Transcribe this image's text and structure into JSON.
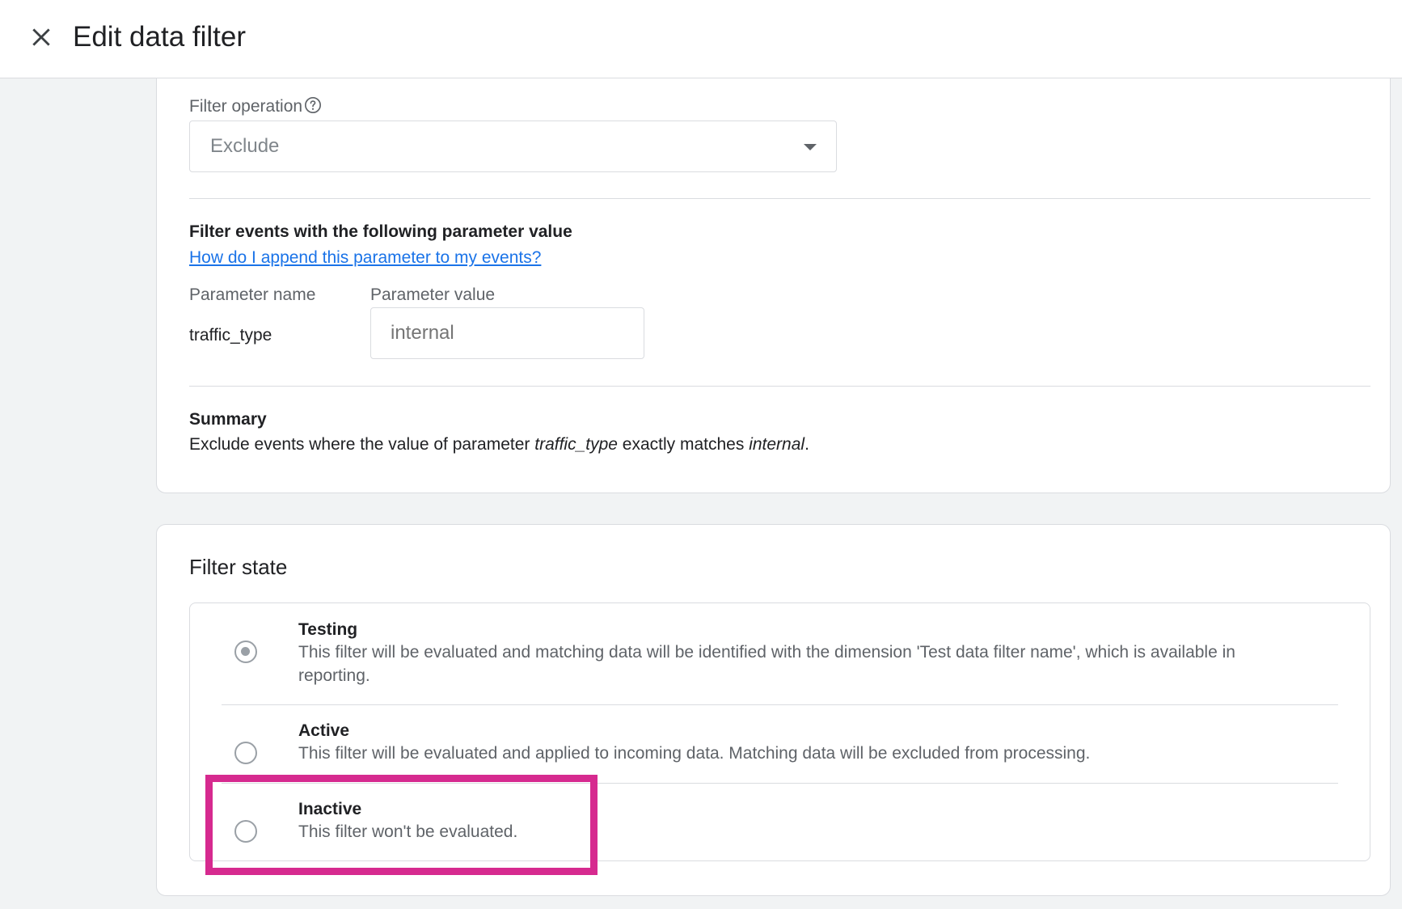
{
  "header": {
    "title": "Edit data filter",
    "close_icon": "close-icon"
  },
  "filter_operation": {
    "label": "Filter operation",
    "help_icon": "help-circle-icon",
    "selected": "Exclude"
  },
  "parameter_section": {
    "heading": "Filter events with the following parameter value",
    "help_link": "How do I append this parameter to my events?",
    "param_name_header": "Parameter name",
    "param_value_header": "Parameter value",
    "param_name": "traffic_type",
    "param_value_placeholder": "internal"
  },
  "summary": {
    "heading": "Summary",
    "text_prefix": "Exclude events where the value of parameter ",
    "param": "traffic_type",
    "text_middle": " exactly matches ",
    "value": "internal",
    "text_suffix": "."
  },
  "filter_state": {
    "title": "Filter state",
    "selected": "Testing",
    "options": [
      {
        "label": "Testing",
        "description": "This filter will be evaluated and matching data will be identified with the dimension 'Test data filter name', which is available in reporting."
      },
      {
        "label": "Active",
        "description": "This filter will be evaluated and applied to incoming data. Matching data will be excluded from processing."
      },
      {
        "label": "Inactive",
        "description": "This filter won't be evaluated."
      }
    ]
  },
  "colors": {
    "link": "#1a73e8",
    "highlight": "#d62a8f",
    "radio": "#9aa0a6"
  }
}
